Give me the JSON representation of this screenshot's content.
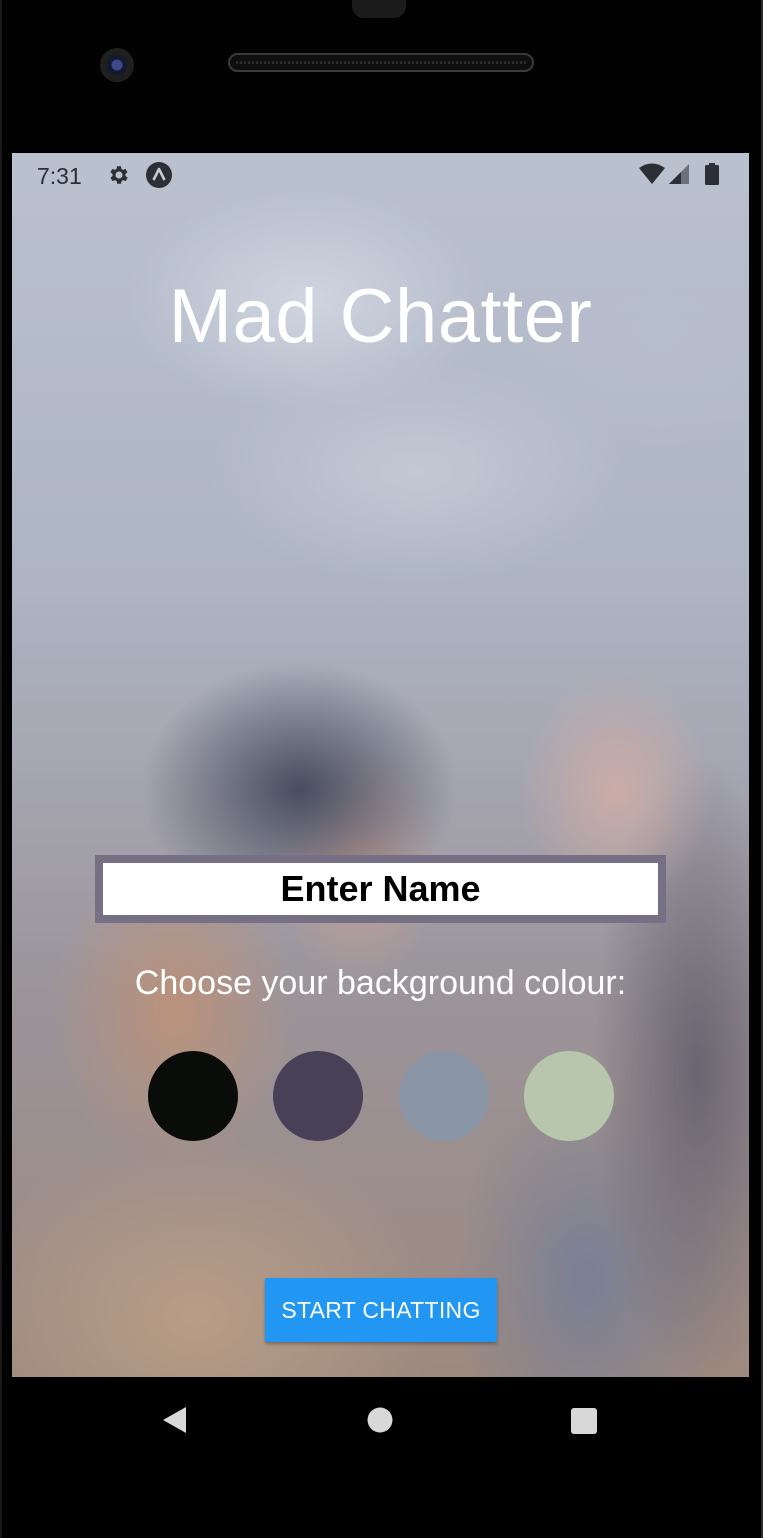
{
  "status_bar": {
    "time": "7:31",
    "icons": [
      "gear-icon",
      "a-badge-icon",
      "wifi-icon",
      "cell-signal-icon",
      "battery-icon"
    ]
  },
  "app": {
    "title": "Mad Chatter"
  },
  "name_field": {
    "placeholder": "Enter Name",
    "value": ""
  },
  "colour_picker": {
    "label": "Choose your background colour:",
    "options": [
      {
        "color": "#090C08"
      },
      {
        "color": "#474056"
      },
      {
        "color": "#8A95A5"
      },
      {
        "color": "#B9C6AE"
      }
    ]
  },
  "start_button": {
    "label": "START CHATTING",
    "color": "#2196F3"
  },
  "nav_bar": {
    "icons": [
      "back-icon",
      "home-icon",
      "recent-apps-icon"
    ]
  }
}
